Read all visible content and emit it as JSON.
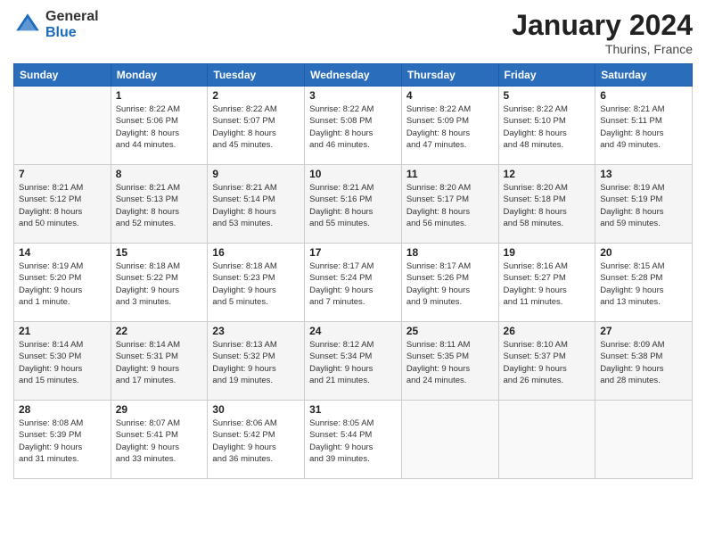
{
  "header": {
    "logo_general": "General",
    "logo_blue": "Blue",
    "month_title": "January 2024",
    "subtitle": "Thurins, France"
  },
  "days_of_week": [
    "Sunday",
    "Monday",
    "Tuesday",
    "Wednesday",
    "Thursday",
    "Friday",
    "Saturday"
  ],
  "weeks": [
    [
      {
        "day": "",
        "info": ""
      },
      {
        "day": "1",
        "info": "Sunrise: 8:22 AM\nSunset: 5:06 PM\nDaylight: 8 hours\nand 44 minutes."
      },
      {
        "day": "2",
        "info": "Sunrise: 8:22 AM\nSunset: 5:07 PM\nDaylight: 8 hours\nand 45 minutes."
      },
      {
        "day": "3",
        "info": "Sunrise: 8:22 AM\nSunset: 5:08 PM\nDaylight: 8 hours\nand 46 minutes."
      },
      {
        "day": "4",
        "info": "Sunrise: 8:22 AM\nSunset: 5:09 PM\nDaylight: 8 hours\nand 47 minutes."
      },
      {
        "day": "5",
        "info": "Sunrise: 8:22 AM\nSunset: 5:10 PM\nDaylight: 8 hours\nand 48 minutes."
      },
      {
        "day": "6",
        "info": "Sunrise: 8:21 AM\nSunset: 5:11 PM\nDaylight: 8 hours\nand 49 minutes."
      }
    ],
    [
      {
        "day": "7",
        "info": "Sunrise: 8:21 AM\nSunset: 5:12 PM\nDaylight: 8 hours\nand 50 minutes."
      },
      {
        "day": "8",
        "info": "Sunrise: 8:21 AM\nSunset: 5:13 PM\nDaylight: 8 hours\nand 52 minutes."
      },
      {
        "day": "9",
        "info": "Sunrise: 8:21 AM\nSunset: 5:14 PM\nDaylight: 8 hours\nand 53 minutes."
      },
      {
        "day": "10",
        "info": "Sunrise: 8:21 AM\nSunset: 5:16 PM\nDaylight: 8 hours\nand 55 minutes."
      },
      {
        "day": "11",
        "info": "Sunrise: 8:20 AM\nSunset: 5:17 PM\nDaylight: 8 hours\nand 56 minutes."
      },
      {
        "day": "12",
        "info": "Sunrise: 8:20 AM\nSunset: 5:18 PM\nDaylight: 8 hours\nand 58 minutes."
      },
      {
        "day": "13",
        "info": "Sunrise: 8:19 AM\nSunset: 5:19 PM\nDaylight: 8 hours\nand 59 minutes."
      }
    ],
    [
      {
        "day": "14",
        "info": "Sunrise: 8:19 AM\nSunset: 5:20 PM\nDaylight: 9 hours\nand 1 minute."
      },
      {
        "day": "15",
        "info": "Sunrise: 8:18 AM\nSunset: 5:22 PM\nDaylight: 9 hours\nand 3 minutes."
      },
      {
        "day": "16",
        "info": "Sunrise: 8:18 AM\nSunset: 5:23 PM\nDaylight: 9 hours\nand 5 minutes."
      },
      {
        "day": "17",
        "info": "Sunrise: 8:17 AM\nSunset: 5:24 PM\nDaylight: 9 hours\nand 7 minutes."
      },
      {
        "day": "18",
        "info": "Sunrise: 8:17 AM\nSunset: 5:26 PM\nDaylight: 9 hours\nand 9 minutes."
      },
      {
        "day": "19",
        "info": "Sunrise: 8:16 AM\nSunset: 5:27 PM\nDaylight: 9 hours\nand 11 minutes."
      },
      {
        "day": "20",
        "info": "Sunrise: 8:15 AM\nSunset: 5:28 PM\nDaylight: 9 hours\nand 13 minutes."
      }
    ],
    [
      {
        "day": "21",
        "info": "Sunrise: 8:14 AM\nSunset: 5:30 PM\nDaylight: 9 hours\nand 15 minutes."
      },
      {
        "day": "22",
        "info": "Sunrise: 8:14 AM\nSunset: 5:31 PM\nDaylight: 9 hours\nand 17 minutes."
      },
      {
        "day": "23",
        "info": "Sunrise: 8:13 AM\nSunset: 5:32 PM\nDaylight: 9 hours\nand 19 minutes."
      },
      {
        "day": "24",
        "info": "Sunrise: 8:12 AM\nSunset: 5:34 PM\nDaylight: 9 hours\nand 21 minutes."
      },
      {
        "day": "25",
        "info": "Sunrise: 8:11 AM\nSunset: 5:35 PM\nDaylight: 9 hours\nand 24 minutes."
      },
      {
        "day": "26",
        "info": "Sunrise: 8:10 AM\nSunset: 5:37 PM\nDaylight: 9 hours\nand 26 minutes."
      },
      {
        "day": "27",
        "info": "Sunrise: 8:09 AM\nSunset: 5:38 PM\nDaylight: 9 hours\nand 28 minutes."
      }
    ],
    [
      {
        "day": "28",
        "info": "Sunrise: 8:08 AM\nSunset: 5:39 PM\nDaylight: 9 hours\nand 31 minutes."
      },
      {
        "day": "29",
        "info": "Sunrise: 8:07 AM\nSunset: 5:41 PM\nDaylight: 9 hours\nand 33 minutes."
      },
      {
        "day": "30",
        "info": "Sunrise: 8:06 AM\nSunset: 5:42 PM\nDaylight: 9 hours\nand 36 minutes."
      },
      {
        "day": "31",
        "info": "Sunrise: 8:05 AM\nSunset: 5:44 PM\nDaylight: 9 hours\nand 39 minutes."
      },
      {
        "day": "",
        "info": ""
      },
      {
        "day": "",
        "info": ""
      },
      {
        "day": "",
        "info": ""
      }
    ]
  ]
}
